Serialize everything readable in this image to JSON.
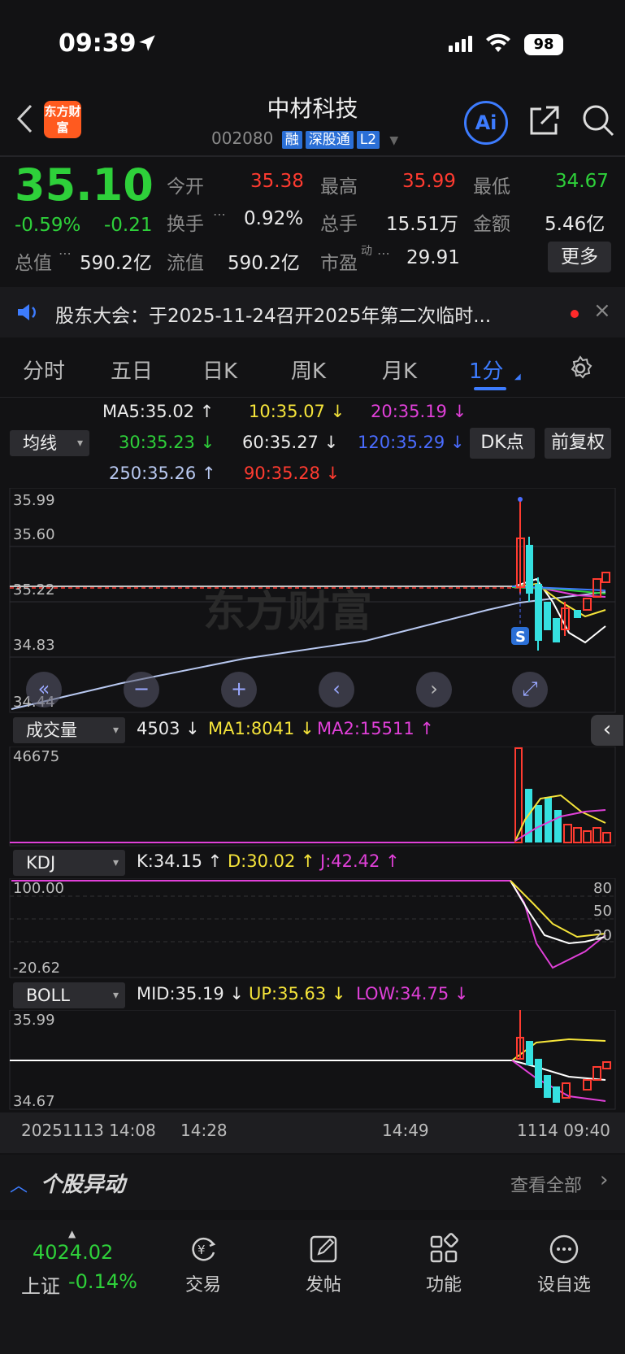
{
  "status": {
    "time": "09:39",
    "battery": "98"
  },
  "header": {
    "logo_text": "东方财富",
    "stock_name": "中材科技",
    "stock_code": "002080",
    "tags": [
      "融",
      "深股通",
      "L2"
    ],
    "ai_label": "Ai"
  },
  "quote": {
    "price": "35.10",
    "change_pct": "-0.59%",
    "change": "-0.21",
    "fields": {
      "open_label": "今开",
      "open": "35.38",
      "high_label": "最高",
      "high": "35.99",
      "low_label": "最低",
      "low": "34.67",
      "turnover_label": "换手",
      "turnover": "0.92%",
      "volume_label": "总手",
      "volume": "15.51万",
      "amount_label": "金额",
      "amount": "5.46亿",
      "mktcap_label": "总值",
      "mktcap": "590.2亿",
      "float_label": "流值",
      "float": "590.2亿",
      "pe_label": "市盈",
      "pe_sup": "动",
      "pe": "29.91"
    },
    "more_label": "更多"
  },
  "notice": {
    "text": "股东大会：于2025-11-24召开2025年第二次临时..."
  },
  "tabs": [
    "分时",
    "五日",
    "日K",
    "周K",
    "月K",
    "1分"
  ],
  "active_tab": "1分",
  "indicator_bar": {
    "ma_select": "均线",
    "ma5": "MA5:35.02 ↑",
    "ma10": "10:35.07 ↓",
    "ma20": "20:35.19 ↓",
    "ma30": "30:35.23 ↓",
    "ma60": "60:35.27 ↓",
    "ma120": "120:35.29 ↓",
    "ma250": "250:35.26 ↑",
    "ma90": "90:35.28 ↓",
    "dk_label": "DK点",
    "adjust_label": "前复权"
  },
  "main_chart": {
    "y_labels": [
      "35.99",
      "35.60",
      "35.22",
      "34.83",
      "34.44"
    ],
    "watermark": "东方财富",
    "signal": "S"
  },
  "volume_panel": {
    "select": "成交量",
    "value": "4503 ↓",
    "ma1": "MA1:8041 ↓",
    "ma2": "MA2:15511 ↑",
    "max_label": "46675"
  },
  "kdj_panel": {
    "select": "KDJ",
    "k": "K:34.15 ↑",
    "d": "D:30.02 ↑",
    "j": "J:42.42 ↑",
    "y_top": "100.00",
    "y_bottom": "-20.62",
    "right_labels": [
      "80",
      "50",
      "20"
    ]
  },
  "boll_panel": {
    "select": "BOLL",
    "mid": "MID:35.19 ↓",
    "up": "UP:35.63 ↓",
    "low": "LOW:34.75 ↓",
    "y_top": "35.99",
    "y_bottom": "34.67"
  },
  "time_axis": [
    "20251113 14:08",
    "14:28",
    "14:49",
    "1114 09:40"
  ],
  "movers": {
    "title": "个股异动",
    "view_all": "查看全部"
  },
  "bottom_nav": {
    "index_value": "4024.02",
    "index_name": "上证",
    "index_change": "-0.14%",
    "items": [
      "交易",
      "发帖",
      "功能",
      "设自选"
    ]
  },
  "colors": {
    "up": "#ff3b30",
    "down": "#2ed03a",
    "accent": "#3d7cff",
    "candle_down": "#35e0e0"
  }
}
